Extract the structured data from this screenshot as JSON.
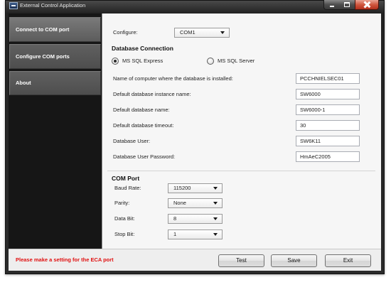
{
  "window": {
    "title": "External Control Application"
  },
  "sidebar": {
    "items": [
      {
        "label": "Connect to COM port",
        "selected": true
      },
      {
        "label": "Configure COM ports",
        "selected": false
      },
      {
        "label": "About",
        "selected": false
      }
    ]
  },
  "configure": {
    "label": "Configure:",
    "value": "COM1"
  },
  "database": {
    "heading": "Database Connection",
    "options": [
      {
        "label": "MS SQL Express",
        "checked": true
      },
      {
        "label": "MS SQL Server",
        "checked": false
      }
    ],
    "fields": [
      {
        "label": "Name of computer where the database is installed:",
        "value": "PCCHNIELSEC01"
      },
      {
        "label": "Default database instance name:",
        "value": "SW6000"
      },
      {
        "label": "Default database name:",
        "value": "SW6000-1"
      },
      {
        "label": "Default database timeout:",
        "value": "30"
      },
      {
        "label": "Database User:",
        "value": "SW6K11"
      },
      {
        "label": "Database User Password:",
        "value": "HmAeC2005"
      }
    ]
  },
  "com_port": {
    "heading": "COM Port",
    "fields": [
      {
        "label": "Baud Rate:",
        "value": "115200"
      },
      {
        "label": "Parity:",
        "value": "None"
      },
      {
        "label": "Data Bit:",
        "value": "8"
      },
      {
        "label": "Stop Bit:",
        "value": "1"
      }
    ]
  },
  "footer": {
    "status": "Please make a setting for the ECA port",
    "test_label": "Test",
    "save_label": "Save",
    "exit_label": "Exit"
  },
  "colors": {
    "status_text": "#e01010",
    "sidebar_bg": "#161616",
    "nav_text": "#ffffff"
  },
  "icons": {
    "app": "app-icon",
    "minimize": "minimize-icon",
    "maximize": "maximize-icon",
    "close": "close-icon",
    "dropdown": "chevron-down-icon"
  }
}
